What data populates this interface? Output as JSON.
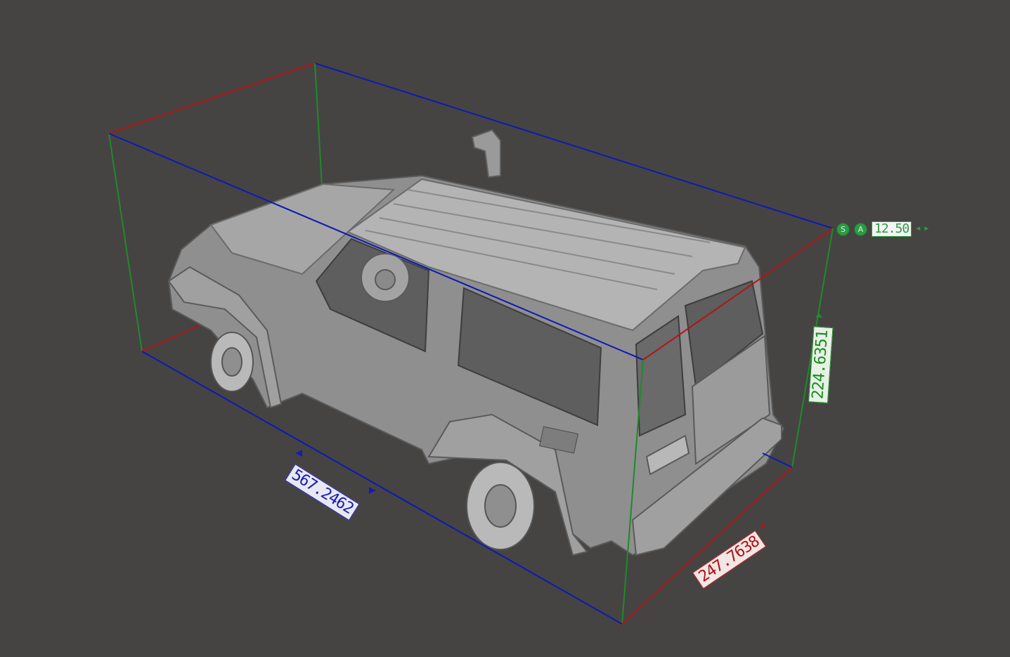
{
  "viewport": {
    "background": "#454443",
    "model": "3d-suv-model",
    "bounding_box_colors": {
      "length": "#0c1ab4",
      "width": "#b41414",
      "height": "#1f8a2a"
    }
  },
  "dimensions": {
    "length": "567.2462",
    "width": "247.7638",
    "height": "224.6351"
  },
  "snap_toolbar": {
    "snap_label": "S",
    "angle_label": "A",
    "value": "12.50",
    "decrease_icon": "arrow-left-icon",
    "increase_icon": "arrow-right-icon"
  }
}
